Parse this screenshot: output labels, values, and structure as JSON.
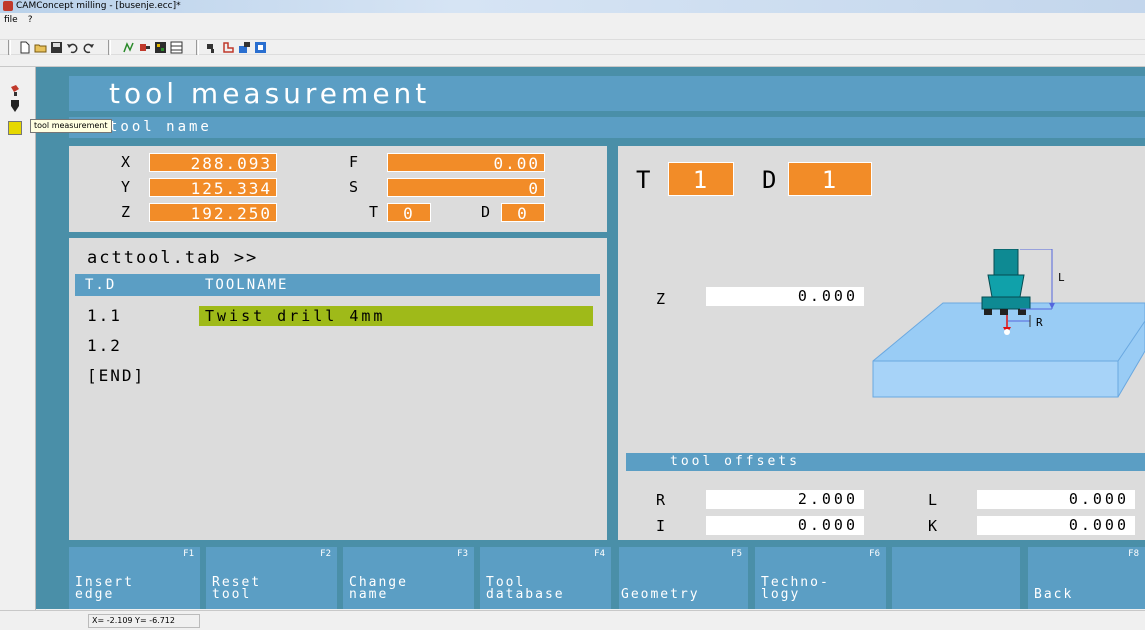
{
  "window": {
    "title": "CAMConcept milling - [busenje.ecc]*"
  },
  "menu": [
    "file",
    "?"
  ],
  "tooltip": "tool measurement",
  "header": {
    "title": "tool measurement",
    "subtitle": "tool name"
  },
  "position": {
    "x_label": "X",
    "x_value": "288.093",
    "y_label": "Y",
    "y_value": "125.334",
    "z_label": "Z",
    "z_value": "192.250",
    "f_label": "F",
    "f_value": "0.00",
    "s_label": "S",
    "s_value": "0",
    "t_label": "T",
    "t_value": "0",
    "d_label": "D",
    "d_value": "0"
  },
  "tool_list": {
    "title": "acttool.tab >>",
    "columns": [
      "T.D",
      "TOOLNAME"
    ],
    "rows": [
      {
        "td": "1.1",
        "name": "Twist drill 4mm"
      },
      {
        "td": "1.2",
        "name": ""
      },
      {
        "td": "[END]",
        "name": ""
      }
    ]
  },
  "tool_select": {
    "t_label": "T",
    "t_value": "1",
    "d_label": "D",
    "d_value": "1"
  },
  "measure": {
    "z_label": "Z",
    "z_value": "0.000"
  },
  "diagram": {
    "l_label": "L",
    "r_label": "R"
  },
  "offsets": {
    "title": "tool offsets",
    "r_label": "R",
    "r_value": "2.000",
    "l_label": "L",
    "l_value": "0.000",
    "i_label": "I",
    "i_value": "0.000",
    "k_label": "K",
    "k_value": "0.000"
  },
  "fkeys": [
    {
      "key": "F1",
      "label": "Insert\nedge"
    },
    {
      "key": "F2",
      "label": "Reset\ntool"
    },
    {
      "key": "F3",
      "label": "Change\nname"
    },
    {
      "key": "F4",
      "label": "Tool\ndatabase"
    },
    {
      "key": "F5",
      "label": "Geometry"
    },
    {
      "key": "F6",
      "label": "Techno-\nlogy"
    },
    {
      "key": "",
      "label": ""
    },
    {
      "key": "F8",
      "label": "Back"
    }
  ],
  "status": {
    "coords": "X= -2.109 Y= -6.712"
  },
  "colors": {
    "background": "#4a8fa8",
    "bar": "#5b9ec4",
    "panel": "#dcdcdc",
    "value_box": "#f28c28",
    "highlight": "#9fba19",
    "work_piece": "#99ccf5"
  }
}
